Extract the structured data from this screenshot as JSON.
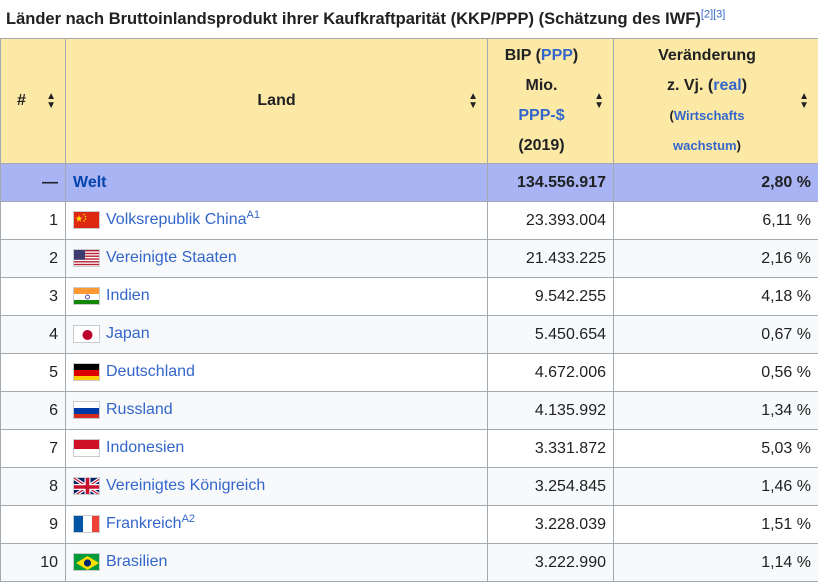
{
  "caption": {
    "title": "Länder nach Bruttoinlandsprodukt ihrer Kaufkraftparität (KKP/PPP) (Schätzung des IWF)",
    "ref1": "[2]",
    "ref2": "[3]"
  },
  "headers": {
    "rank": "#",
    "land": "Land",
    "bip_1": "BIP (",
    "bip_ppp": "PPP",
    "bip_2": ")",
    "bip_3": "Mio.",
    "bip_4": "PPP-$",
    "bip_5": "(2019)",
    "ver_1": "Veränderung",
    "ver_2": "z. Vj. (",
    "ver_real": "real",
    "ver_3": ")",
    "ver_4a": "(",
    "ver_4": "Wirtschafts",
    "ver_5": "wachstum",
    "ver_6": ")"
  },
  "world": {
    "rank": "—",
    "name": "Welt",
    "bip": "134.556.917",
    "change": "2,80 %"
  },
  "rows": [
    {
      "rank": "1",
      "name": "Volksrepublik China",
      "sup": "A1",
      "bip": "23.393.004",
      "change": "6,11 %",
      "flag": "cn"
    },
    {
      "rank": "2",
      "name": "Vereinigte Staaten",
      "sup": "",
      "bip": "21.433.225",
      "change": "2,16 %",
      "flag": "us"
    },
    {
      "rank": "3",
      "name": "Indien",
      "sup": "",
      "bip": "9.542.255",
      "change": "4,18 %",
      "flag": "in"
    },
    {
      "rank": "4",
      "name": "Japan",
      "sup": "",
      "bip": "5.450.654",
      "change": "0,67 %",
      "flag": "jp"
    },
    {
      "rank": "5",
      "name": "Deutschland",
      "sup": "",
      "bip": "4.672.006",
      "change": "0,56 %",
      "flag": "de"
    },
    {
      "rank": "6",
      "name": "Russland",
      "sup": "",
      "bip": "4.135.992",
      "change": "1,34 %",
      "flag": "ru"
    },
    {
      "rank": "7",
      "name": "Indonesien",
      "sup": "",
      "bip": "3.331.872",
      "change": "5,03 %",
      "flag": "id"
    },
    {
      "rank": "8",
      "name": "Vereinigtes Königreich",
      "sup": "",
      "bip": "3.254.845",
      "change": "1,46 %",
      "flag": "gb"
    },
    {
      "rank": "9",
      "name": "Frankreich",
      "sup": "A2",
      "bip": "3.228.039",
      "change": "1,51 %",
      "flag": "fr"
    },
    {
      "rank": "10",
      "name": "Brasilien",
      "sup": "",
      "bip": "3.222.990",
      "change": "1,14 %",
      "flag": "br"
    }
  ],
  "colors": {
    "header_bg": "#fde9a6",
    "world_bg": "#a8b4f4",
    "link": "#3366cc",
    "border": "#a2a9b1"
  }
}
